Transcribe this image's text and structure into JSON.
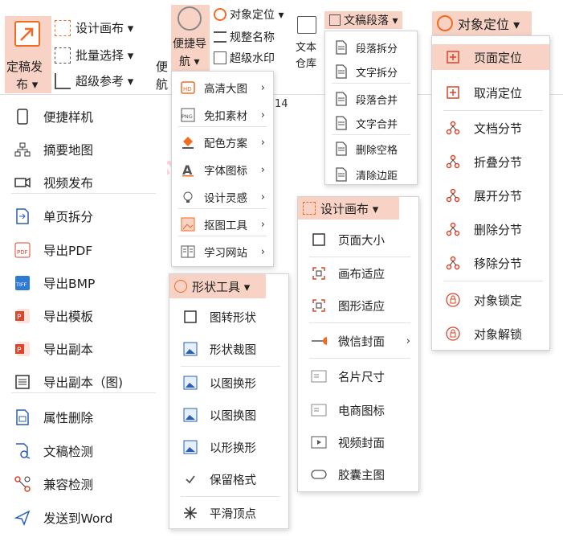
{
  "ribbon": {
    "finalize": {
      "line1": "定稿发",
      "line2": "布 ▾"
    },
    "design_canvas": "设计画布 ▾",
    "batch_select": "批量选择 ▾",
    "super_ref": "超级参考 ▾",
    "convenient_nav": {
      "line1": "便捷导",
      "line2": "航 ▾"
    },
    "nav_partial": {
      "line1": "便",
      "line2": "航"
    },
    "object_pos_small": "对象定位 ▾",
    "normalize_name": "规整名称",
    "super_watermark": "超级水印",
    "text_lib": {
      "line1": "文本",
      "line2": "仓库"
    },
    "text_para": "文稿段落 ▾",
    "object_pos_big": "对象定位 ▾",
    "stray_number": "14"
  },
  "left_menu": [
    {
      "label": "便捷样机",
      "icon": "phone-icon"
    },
    {
      "label": "摘要地图",
      "icon": "sitemap-icon"
    },
    {
      "label": "视频发布",
      "icon": "video-icon"
    },
    {
      "label": "单页拆分",
      "icon": "doc-split-icon"
    },
    {
      "label": "导出PDF",
      "icon": "pdf-icon"
    },
    {
      "label": "导出BMP",
      "icon": "tiff-icon"
    },
    {
      "label": "导出模板",
      "icon": "ppt-icon"
    },
    {
      "label": "导出副本",
      "icon": "ppt-icon"
    },
    {
      "label": "导出副本（图)",
      "icon": "doc-lines-icon"
    },
    {
      "label": "属性删除",
      "icon": "attr-delete-icon"
    },
    {
      "label": "文稿检测",
      "icon": "doc-check-icon"
    },
    {
      "label": "兼容检测",
      "icon": "compat-icon"
    },
    {
      "label": "发送到Word",
      "icon": "word-icon"
    }
  ],
  "nav_menu": [
    {
      "label": "高清大图",
      "icon": "hd-icon"
    },
    {
      "label": "免扣素材",
      "icon": "png-icon"
    },
    {
      "label": "配色方案",
      "icon": "paint-bucket-icon"
    },
    {
      "label": "字体图标",
      "icon": "font-icon"
    },
    {
      "label": "设计灵感",
      "icon": "bulb-icon"
    },
    {
      "label": "抠图工具",
      "icon": "image-tool-icon"
    },
    {
      "label": "学习网站",
      "icon": "book-icon"
    }
  ],
  "para_menu": [
    {
      "label": "段落拆分"
    },
    {
      "label": "文字拆分"
    },
    {
      "label": "段落合并"
    },
    {
      "label": "文字合并"
    },
    {
      "label": "删除空格"
    },
    {
      "label": "清除边距"
    }
  ],
  "shape_menu": {
    "header": "形状工具 ▾",
    "items": [
      {
        "label": "图转形状"
      },
      {
        "label": "形状裁图"
      },
      {
        "label": "以图换形"
      },
      {
        "label": "以图换图"
      },
      {
        "label": "以形换形"
      },
      {
        "label": "保留格式"
      },
      {
        "label": "平滑顶点"
      }
    ]
  },
  "canvas_menu": {
    "header": "设计画布 ▾",
    "items": [
      {
        "label": "页面大小"
      },
      {
        "label": "画布适应"
      },
      {
        "label": "图形适应"
      },
      {
        "label": "微信封面"
      },
      {
        "label": "名片尺寸"
      },
      {
        "label": "电商图标"
      },
      {
        "label": "视频封面"
      },
      {
        "label": "胶囊主图"
      }
    ]
  },
  "objpos_menu": [
    {
      "label": "页面定位"
    },
    {
      "label": "取消定位"
    },
    {
      "label": "文档分节"
    },
    {
      "label": "折叠分节"
    },
    {
      "label": "展开分节"
    },
    {
      "label": "删除分节"
    },
    {
      "label": "移除分节"
    },
    {
      "label": "对象锁定"
    },
    {
      "label": "对象解锁"
    }
  ],
  "colors": {
    "accent": "#f26b21",
    "highlight": "#f8d3c5",
    "pdf_red": "#d9452b",
    "tiff_blue": "#2f7bd3",
    "word_blue": "#2b5fb4"
  }
}
